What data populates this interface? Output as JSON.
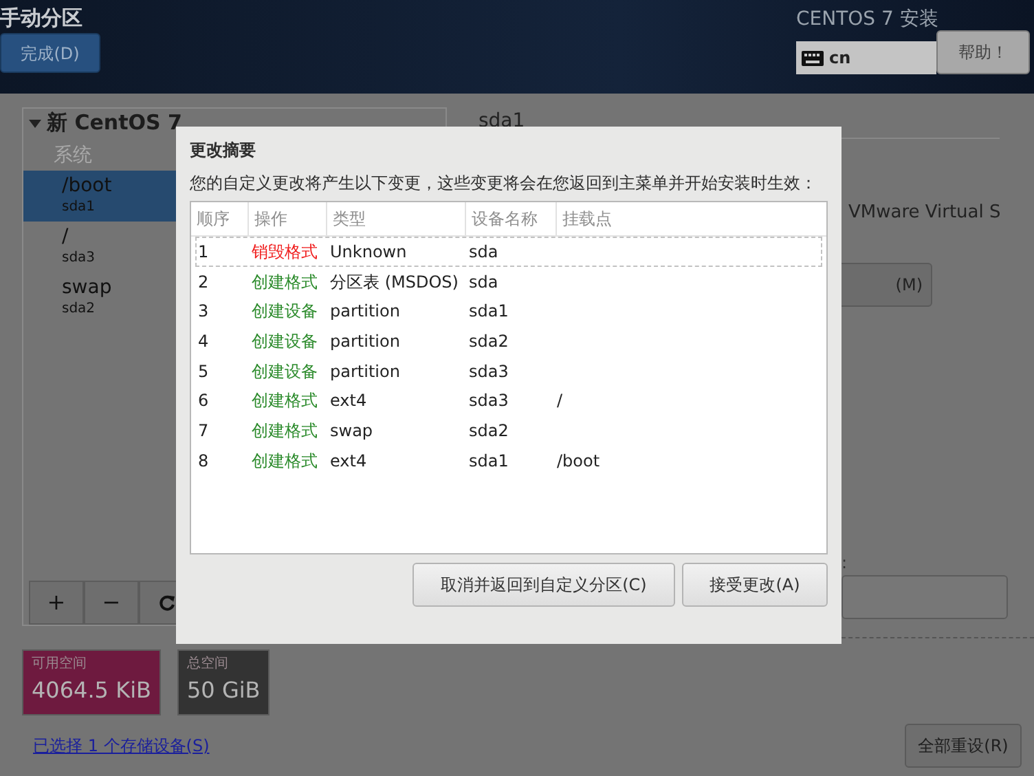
{
  "header": {
    "title": "手动分区",
    "done_button": "完成(D)",
    "product": "CENTOS 7 安装",
    "keyboard": "cn",
    "help_button": "帮助！"
  },
  "left_panel": {
    "heading": "新 CentOS 7",
    "expanded": true,
    "group": "系统",
    "items": [
      {
        "mount": "/boot",
        "device": "sda1",
        "selected": true
      },
      {
        "mount": "/",
        "device": "sda3",
        "selected": false
      },
      {
        "mount": "swap",
        "device": "sda2",
        "selected": false
      }
    ],
    "toolbar": [
      "+",
      "−"
    ]
  },
  "space": [
    {
      "label": "可用空间",
      "value": "4064.5 KiB",
      "color": "#6e1a3f"
    },
    {
      "label": "总空间",
      "value": "50 GiB",
      "color": "#333333"
    }
  ],
  "storage_link": "已选择 1 个存储设备(S)",
  "right_panel": {
    "name": "sda1",
    "device_desc": "VMware Virtual S",
    "modify_button": "(M)",
    "field_label": ":",
    "reset_button": "全部重设(R)"
  },
  "dialog": {
    "title": "更改摘要",
    "description": "您的自定义更改将产生以下变更，这些变更将会在您返回到主菜单并开始安装时生效：",
    "columns": [
      "顺序",
      "操作",
      "类型",
      "设备名称",
      "挂载点"
    ],
    "rows": [
      {
        "order": "1",
        "action": "销毁格式",
        "kind": "destroy",
        "type": "Unknown",
        "device": "sda",
        "selected": true
      },
      {
        "order": "2",
        "action": "创建格式",
        "kind": "create",
        "type": "分区表 (MSDOS)",
        "device": "sda",
        "selected": false
      },
      {
        "order": "3",
        "action": "创建设备",
        "kind": "create",
        "type": "partition",
        "device": "sda1",
        "selected": false
      },
      {
        "order": "4",
        "action": "创建设备",
        "kind": "create",
        "type": "partition",
        "device": "sda2",
        "selected": false
      },
      {
        "order": "5",
        "action": "创建设备",
        "kind": "create",
        "type": "partition",
        "device": "sda3",
        "selected": false
      },
      {
        "order": "6",
        "action": "创建格式",
        "kind": "create",
        "type": "ext4",
        "device": "sda3",
        "mount": "/",
        "selected": false
      },
      {
        "order": "7",
        "action": "创建格式",
        "kind": "create",
        "type": "swap",
        "device": "sda2",
        "selected": false
      },
      {
        "order": "8",
        "action": "创建格式",
        "kind": "create",
        "type": "ext4",
        "device": "sda1",
        "mount": "/boot",
        "selected": false
      }
    ],
    "buttons": [
      "取消并返回到自定义分区(C)",
      "接受更改(A)"
    ]
  }
}
